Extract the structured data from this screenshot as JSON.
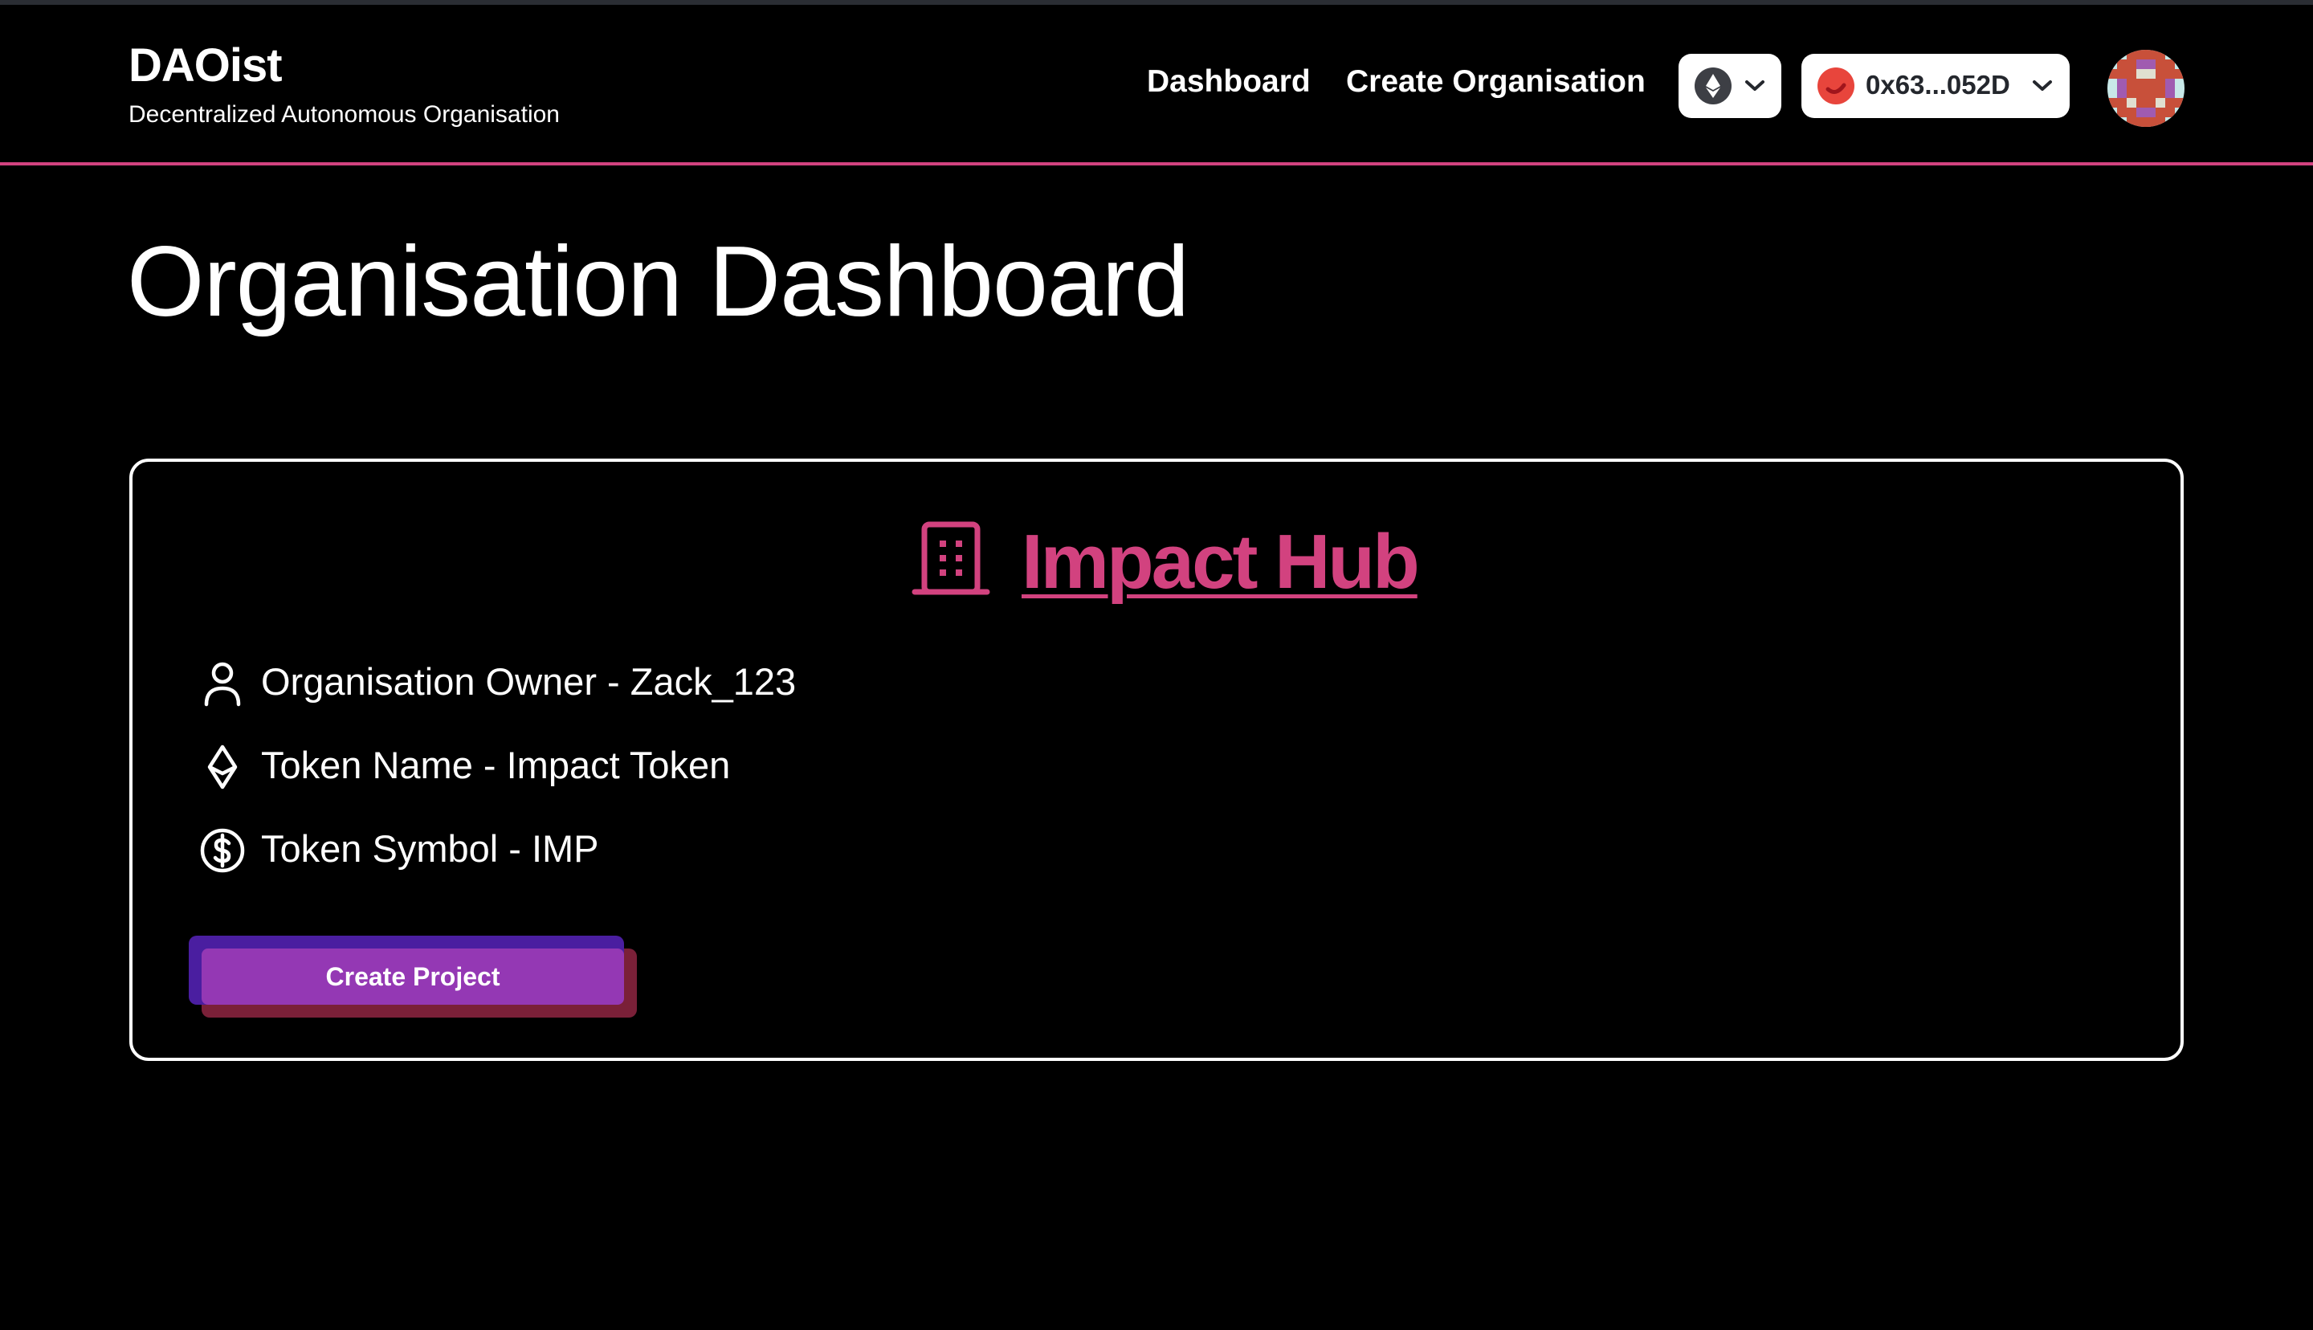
{
  "brand": {
    "title": "DAOist",
    "subtitle": "Decentralized Autonomous Organisation"
  },
  "nav": {
    "dashboard": "Dashboard",
    "create_organisation": "Create Organisation"
  },
  "wallet": {
    "chain_icon": "ethereum-icon",
    "account_label": "0x63...052D"
  },
  "page": {
    "title": "Organisation Dashboard"
  },
  "organisation": {
    "name": "Impact Hub",
    "details": {
      "owner": "Organisation Owner - Zack_123",
      "token_name": "Token Name - Impact Token",
      "token_symbol": "Token Symbol - IMP"
    },
    "create_project_label": "Create Project"
  },
  "colors": {
    "accent": "#d2427f",
    "background": "#000000",
    "button": "#9438b4"
  }
}
